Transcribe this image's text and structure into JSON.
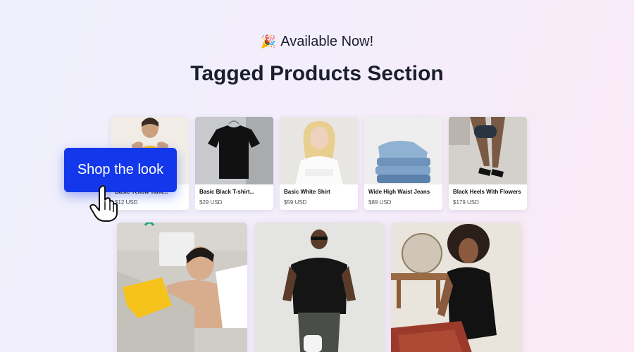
{
  "header": {
    "badge_icon": "party-popper-icon",
    "badge_emoji": "🎉",
    "badge_text": "Available Now!",
    "title": "Tagged Products Section"
  },
  "products": [
    {
      "name": "Basic Yellow Tank...",
      "price": "$12 USD"
    },
    {
      "name": "Basic Black T-shirt...",
      "price": "$29 USD"
    },
    {
      "name": "Basic White Shirt",
      "price": "$59 USD"
    },
    {
      "name": "Wide High Waist Jeans",
      "price": "$89 USD"
    },
    {
      "name": "Black Heels With Flowers",
      "price": "$179 USD"
    }
  ],
  "cta": {
    "label": "Shop the look",
    "color": "#1338ec"
  },
  "cursor_icon": "hand-pointer-icon"
}
